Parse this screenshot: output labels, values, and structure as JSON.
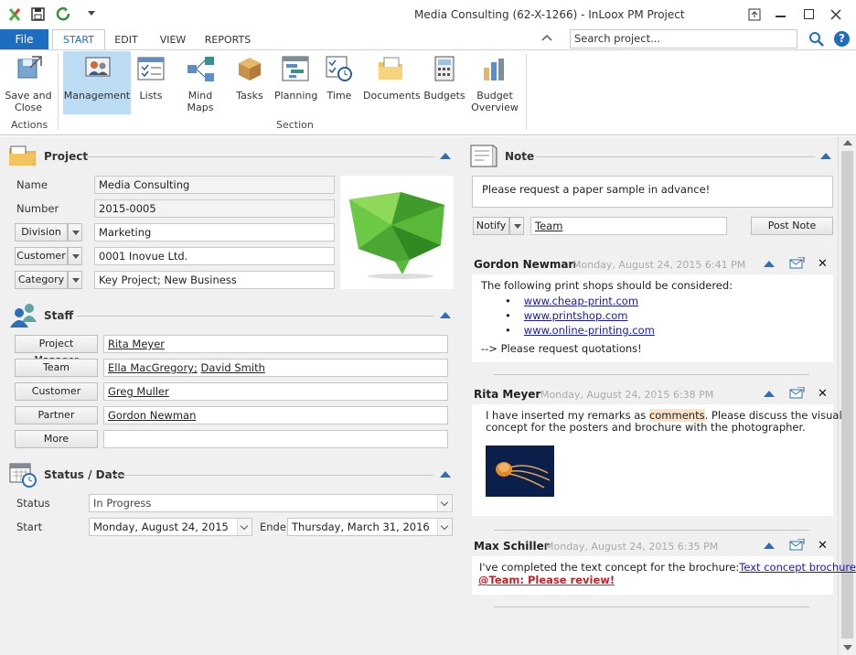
{
  "window": {
    "title": "Media Consulting (62-X-1266) - InLoox PM Project"
  },
  "tabs": {
    "file": "File",
    "start": "START",
    "edit": "EDIT",
    "view": "VIEW",
    "reports": "REPORTS"
  },
  "search": {
    "placeholder": "Search project..."
  },
  "ribbon": {
    "save": "Save and",
    "close": "Close",
    "management": "Management",
    "lists": "Lists",
    "mindmaps": "Mind Maps",
    "tasks": "Tasks",
    "planning": "Planning",
    "time": "Time",
    "documents": "Documents",
    "budgets": "Budgets",
    "budget1": "Budget",
    "budget2": "Overview",
    "group_actions": "Actions",
    "group_section": "Section"
  },
  "project": {
    "heading": "Project",
    "name_label": "Name",
    "name_value": "Media Consulting",
    "number_label": "Number",
    "number_value": "2015-0005",
    "division_label": "Division",
    "division_value": "Marketing",
    "customer_label": "Customer",
    "customer_value": "0001 Inovue Ltd.",
    "category_label": "Category",
    "category_value": "Key Project; New Business"
  },
  "staff": {
    "heading": "Staff",
    "pm_label": "Project Manager",
    "pm_value": "Rita Meyer",
    "team_label": "Team",
    "team_value1": "Ella MacGregory;",
    "team_value2": "David Smith",
    "customer_label": "Customer",
    "customer_value": "Greg Muller",
    "partner_label": "Partner",
    "partner_value": "Gordon Newman",
    "more_label": "More"
  },
  "status": {
    "heading": "Status / Date",
    "status_label": "Status",
    "status_value": "In Progress",
    "start_label": "Start",
    "start_value": "Monday, August 24, 2015",
    "end_label": "Ende",
    "end_value": "Thursday, March 31, 2016"
  },
  "note": {
    "heading": "Note",
    "text": "Please request a paper sample in advance!",
    "notify": "Notify",
    "team": "Team",
    "post": "Post Note"
  },
  "posts": [
    {
      "author": "Gordon Newman",
      "date": "Monday, August 24, 2015 6:41 PM",
      "intro": "The following print shops should be considered:",
      "links": [
        "www.cheap-print.com",
        "www.printshop.com",
        "www.online-printing.com"
      ],
      "outro": "--> Please request quotations!"
    },
    {
      "author": "Rita Meyer",
      "date": "Monday, August 24, 2015 6:38 PM",
      "line1a": "I have inserted my remarks as ",
      "line1b": "comments",
      "line1c": ". Please discuss the visual",
      "line2": "concept for the posters and brochure with the photographer."
    },
    {
      "author": "Max Schiller",
      "date": "Monday, August 24, 2015 6:35 PM",
      "text": "I've completed the text concept for the brochure:",
      "link": "Text concept brochure",
      "mention": "@Team: Please review!"
    }
  ]
}
